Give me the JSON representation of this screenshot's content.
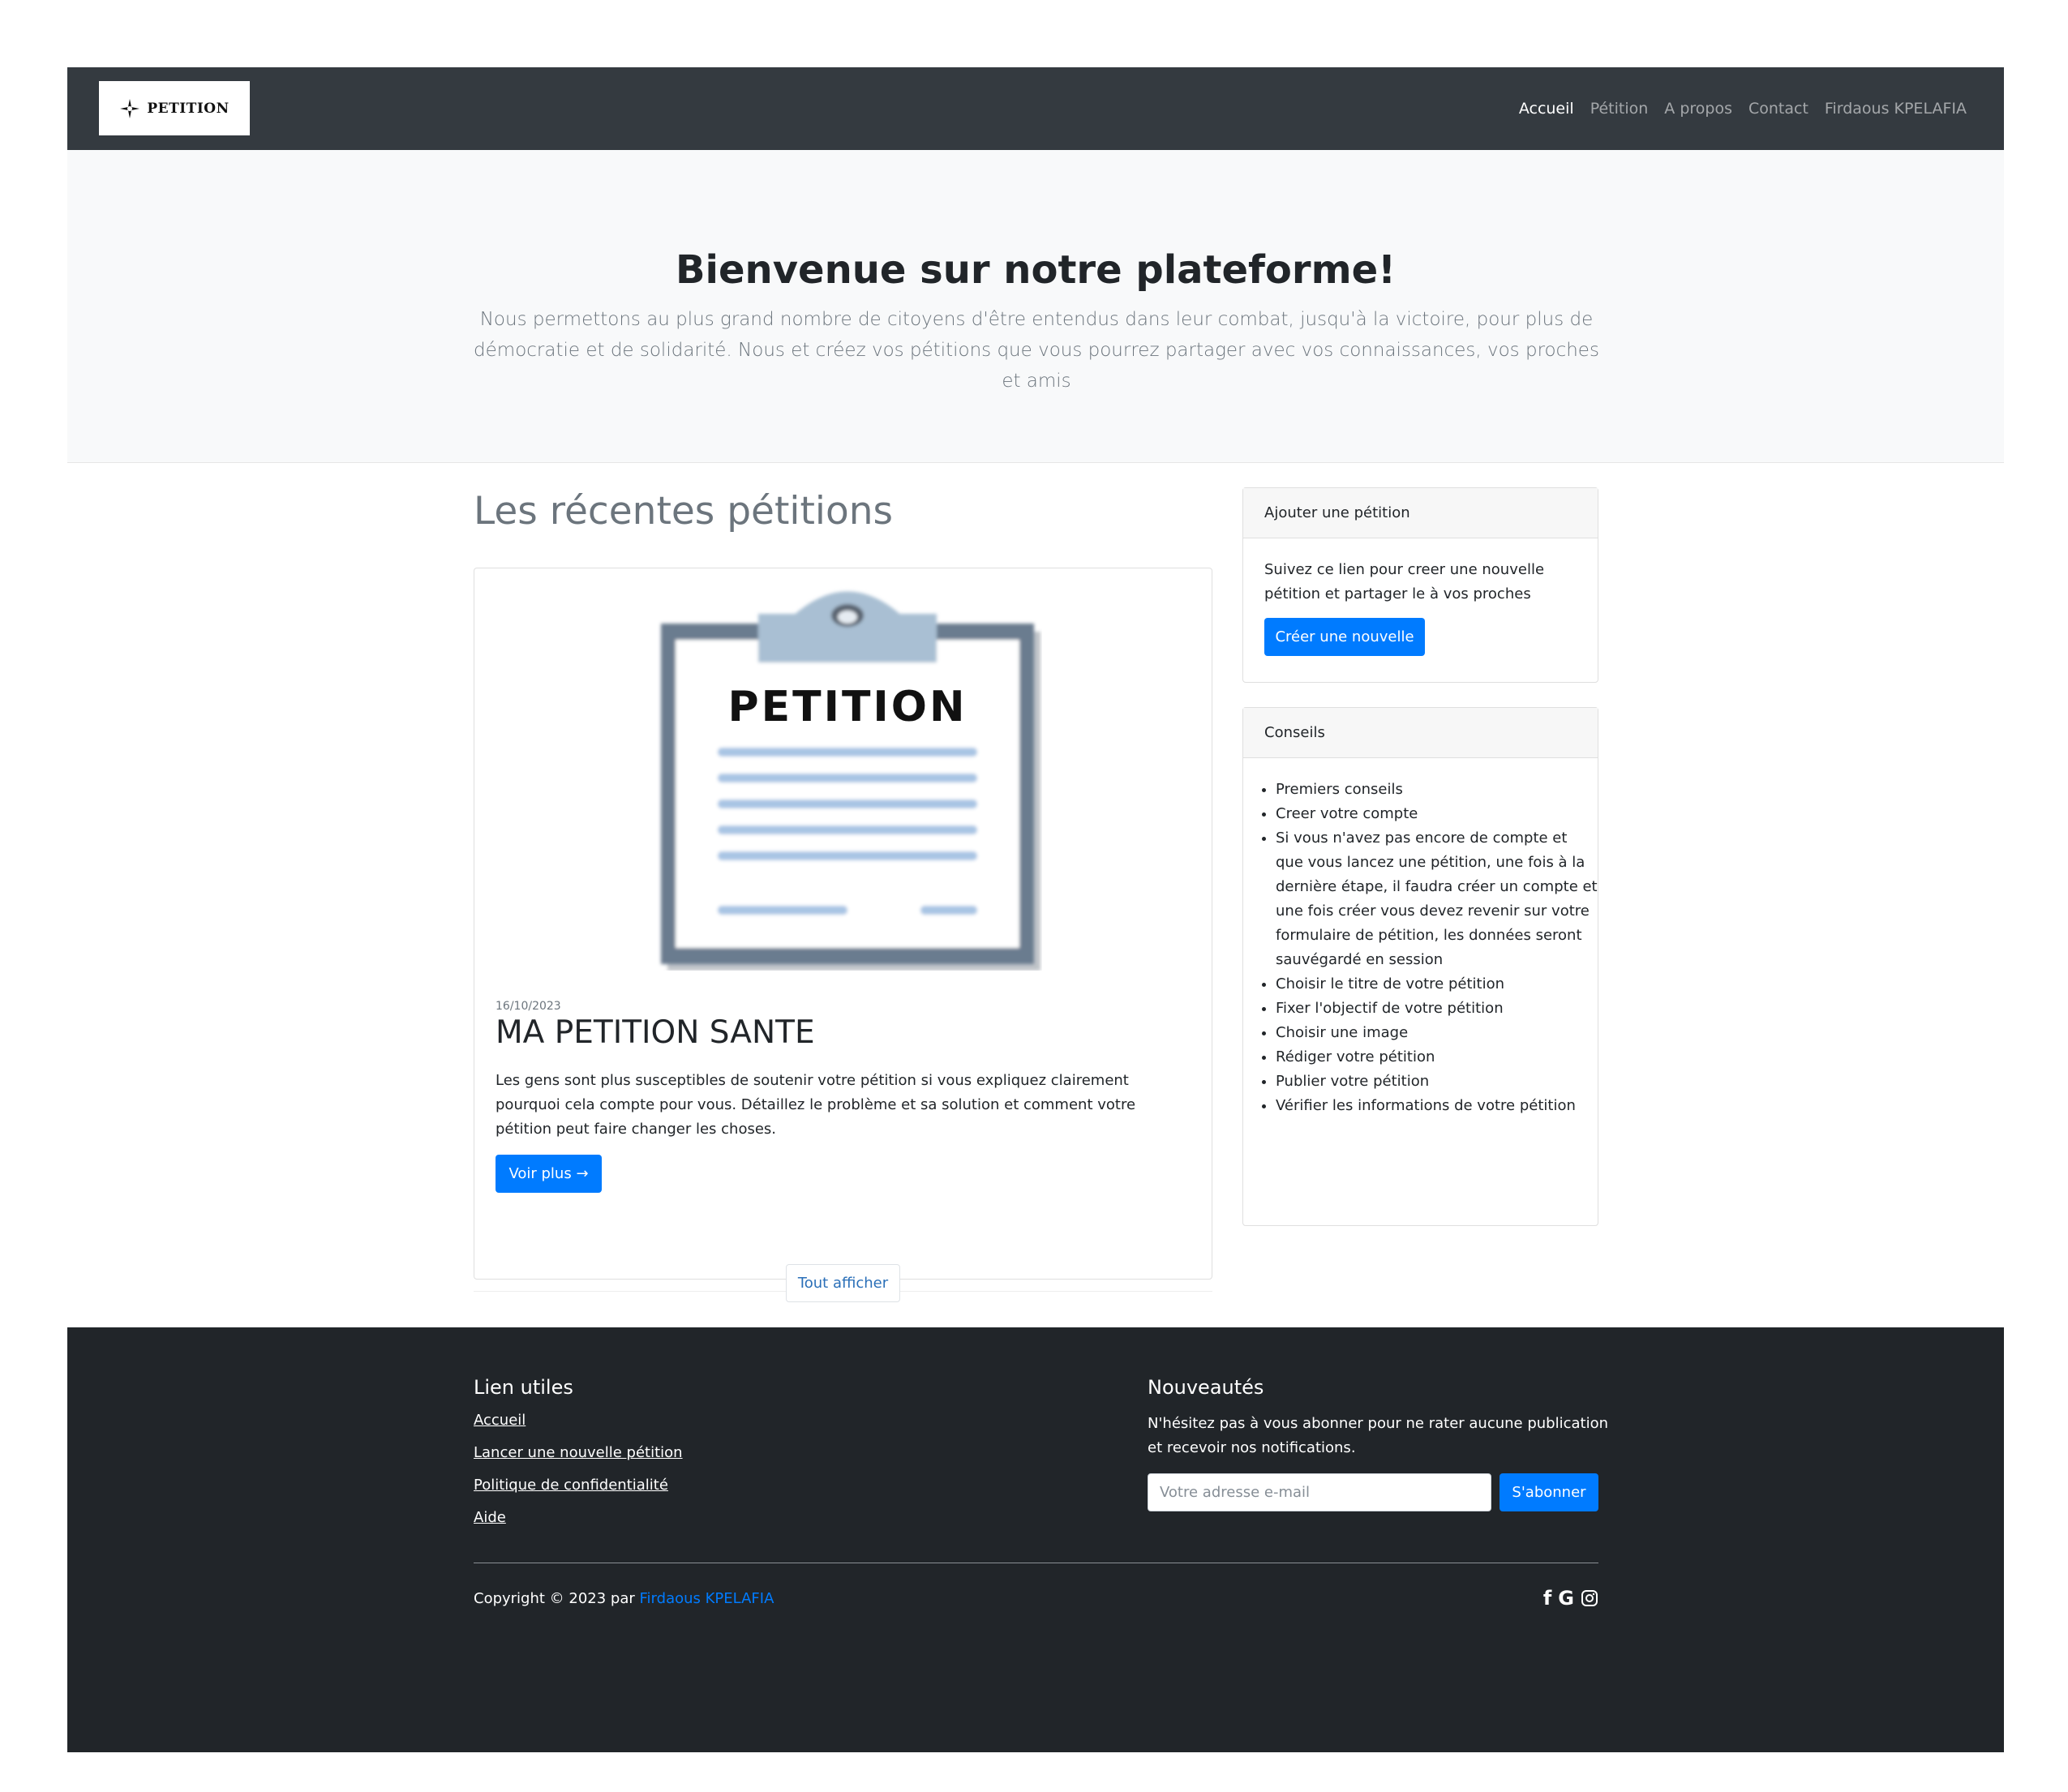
{
  "navbar": {
    "brand": "PETITION",
    "links": [
      "Accueil",
      "Pétition",
      "A propos",
      "Contact",
      "Firdaous KPELAFIA"
    ]
  },
  "hero": {
    "title": "Bienvenue sur notre plateforme!",
    "text": "Nous permettons au plus grand nombre de citoyens d'être entendus dans leur combat, jusqu'à la victoire, pour plus de démocratie et de solidarité. Nous et créez vos pétitions que vous pourrez partager avec vos connaissances, vos proches et amis"
  },
  "main": {
    "section_title": "Les récentes pétitions",
    "post": {
      "image_text": "PETITION",
      "date": "16/10/2023",
      "title": "MA PETITION SANTE",
      "text": "Les gens sont plus susceptibles de soutenir votre pétition si vous expliquez clairement pourquoi cela compte pour vous. Détaillez le problème et sa solution et comment votre pétition peut faire changer les choses.",
      "button": "Voir plus →"
    },
    "show_all": "Tout afficher"
  },
  "sidebar": {
    "add_card": {
      "header": "Ajouter une pétition",
      "text": "Suivez ce lien pour creer une nouvelle pétition et partager le à vos proches",
      "button": "Créer une nouvelle"
    },
    "tips_card": {
      "header": "Conseils",
      "items": [
        "Premiers conseils",
        "Creer votre compte",
        "Si vous n'avez pas encore de compte et que vous lancez une pétition, une fois à la dernière étape, il faudra créer un compte et une fois créer vous devez revenir sur votre formulaire de pétition, les données seront sauvégardé en session",
        "Choisir le titre de votre pétition",
        "Fixer l'objectif de votre pétition",
        "Choisir une image",
        "Rédiger votre pétition",
        "Publier votre pétition",
        "Vérifier les informations de votre pétition"
      ]
    }
  },
  "footer": {
    "links_title": "Lien utiles",
    "links": [
      "Accueil",
      "Lancer une nouvelle pétition",
      "Politique de confidentialité",
      "Aide"
    ],
    "news_title": "Nouveautés",
    "news_text": "N'hésitez pas à vous abonner pour ne rater aucune publication et recevoir nos notifications.",
    "email_placeholder": "Votre adresse e-mail",
    "subscribe": "S'abonner",
    "copyright_prefix": "Copyright © 2023 par ",
    "copyright_author": "Firdaous KPELAFIA",
    "social_icons": [
      "facebook-icon",
      "google-icon",
      "instagram-icon"
    ]
  },
  "colors": {
    "navbar_bg": "#343a40",
    "hero_bg": "#f8f9fa",
    "primary": "#007bff",
    "footer_bg": "#212529"
  }
}
